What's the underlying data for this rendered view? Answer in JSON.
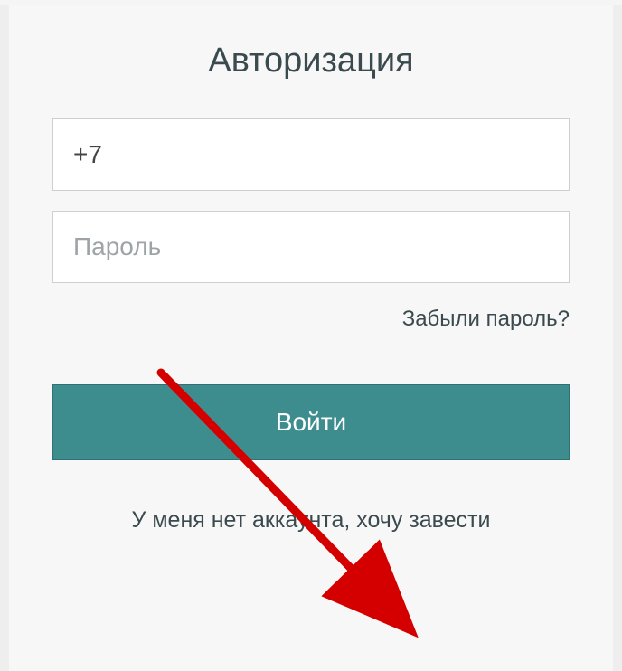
{
  "title": "Авторизация",
  "phone": {
    "value": "+7"
  },
  "password": {
    "placeholder": "Пароль"
  },
  "forgot_label": "Забыли пароль?",
  "login_button_label": "Войти",
  "register_link_label": "У меня нет аккаунта, хочу завести",
  "accent_color": "#3d8d8f",
  "arrow_color": "#d40000"
}
